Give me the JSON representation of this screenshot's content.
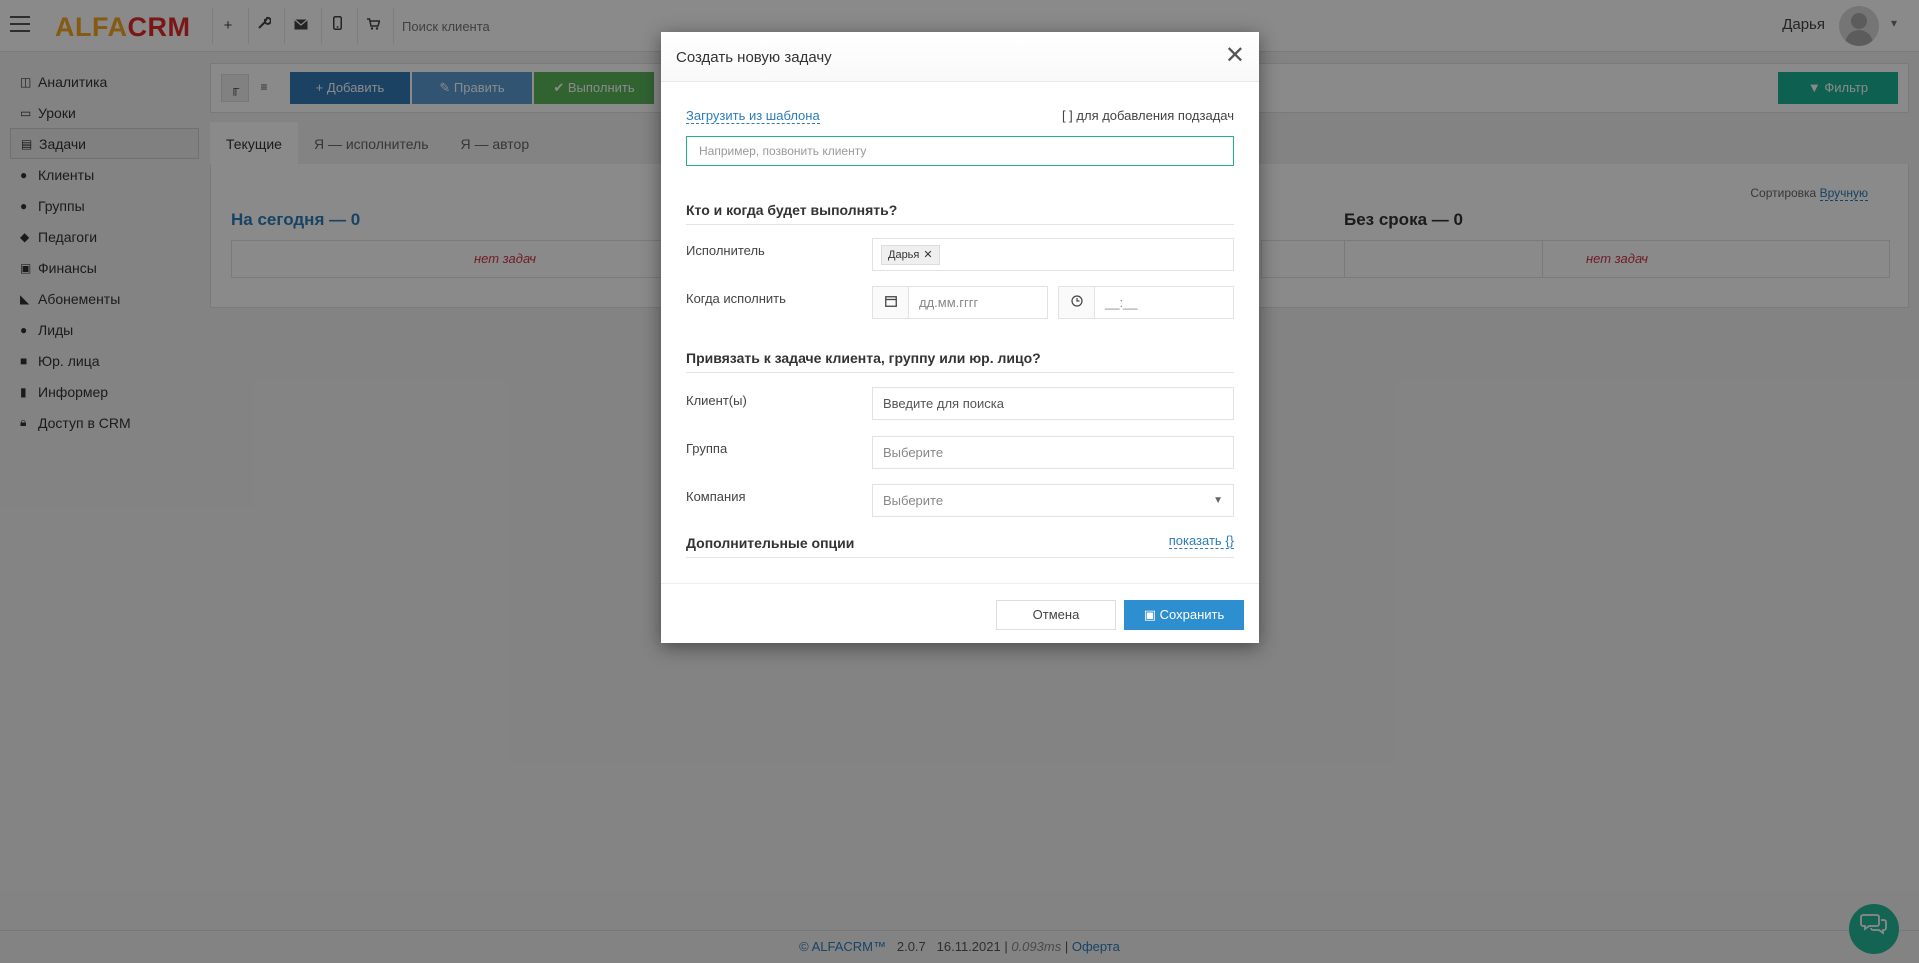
{
  "header": {
    "logo_part1": "ALFA",
    "logo_part2": "CRM",
    "search_placeholder": "Поиск клиента",
    "user_name": "Дарья",
    "toolbar_icons": [
      "plus-icon",
      "wrench-icon",
      "envelope-icon",
      "mobile-icon",
      "cart-icon"
    ]
  },
  "sidebar": {
    "items": [
      {
        "label": "Аналитика",
        "icon": "chart-icon"
      },
      {
        "label": "Уроки",
        "icon": "calendar-icon"
      },
      {
        "label": "Задачи",
        "icon": "clipboard-icon",
        "active": true
      },
      {
        "label": "Клиенты",
        "icon": "user-icon"
      },
      {
        "label": "Группы",
        "icon": "users-icon"
      },
      {
        "label": "Педагоги",
        "icon": "graduation-cap-icon"
      },
      {
        "label": "Финансы",
        "icon": "money-icon"
      },
      {
        "label": "Абонементы",
        "icon": "tag-icon"
      },
      {
        "label": "Лиды",
        "icon": "user-plus-icon"
      },
      {
        "label": "Юр. лица",
        "icon": "briefcase-icon"
      },
      {
        "label": "Информер",
        "icon": "book-icon"
      },
      {
        "label": "Доступ в CRM",
        "icon": "lock-icon"
      }
    ]
  },
  "toolbar": {
    "add_label": "Добавить",
    "edit_label": "Править",
    "complete_label": "Выполнить",
    "filter_label": "Фильтр"
  },
  "tabs": [
    {
      "label": "Текущие",
      "active": true
    },
    {
      "label": "Я — исполнитель"
    },
    {
      "label": "Я — автор"
    }
  ],
  "content": {
    "sort_label": "Сортировка",
    "sort_value": "Вручную",
    "columns": [
      {
        "title": "На сегодня — 0",
        "empty": "нет задач"
      },
      {
        "title": "Без срока — 0",
        "empty": "нет задач"
      }
    ]
  },
  "modal": {
    "title": "Создать новую задачу",
    "load_template": "Загрузить из шаблона",
    "subtask_hint": "[ ] для добавления подзадач",
    "task_placeholder": "Например, позвонить клиенту",
    "section1": "Кто и когда будет выполнять?",
    "executor_label": "Исполнитель",
    "executor_tag": "Дарья",
    "when_label": "Когда исполнить",
    "date_placeholder": "дд.мм.гггг",
    "time_placeholder": "__:__",
    "section2": "Привязать к задаче клиента, группу или юр. лицо?",
    "client_label": "Клиент(ы)",
    "client_placeholder": "Введите для поиска",
    "group_label": "Группа",
    "group_placeholder": "Выберите",
    "company_label": "Компания",
    "company_placeholder": "Выберите",
    "extra_label": "Дополнительные опции",
    "show_label": "показать",
    "cancel_label": "Отмена",
    "save_label": "Сохранить"
  },
  "footer": {
    "copyright": "© ALFACRM™",
    "version": "2.0.7",
    "date": "16.11.2021",
    "timing": "0.093ms",
    "offer": "Оферта"
  },
  "colors": {
    "accent_green": "#1ab394",
    "btn_blue": "#337ab7",
    "danger_text": "#d0344a"
  }
}
